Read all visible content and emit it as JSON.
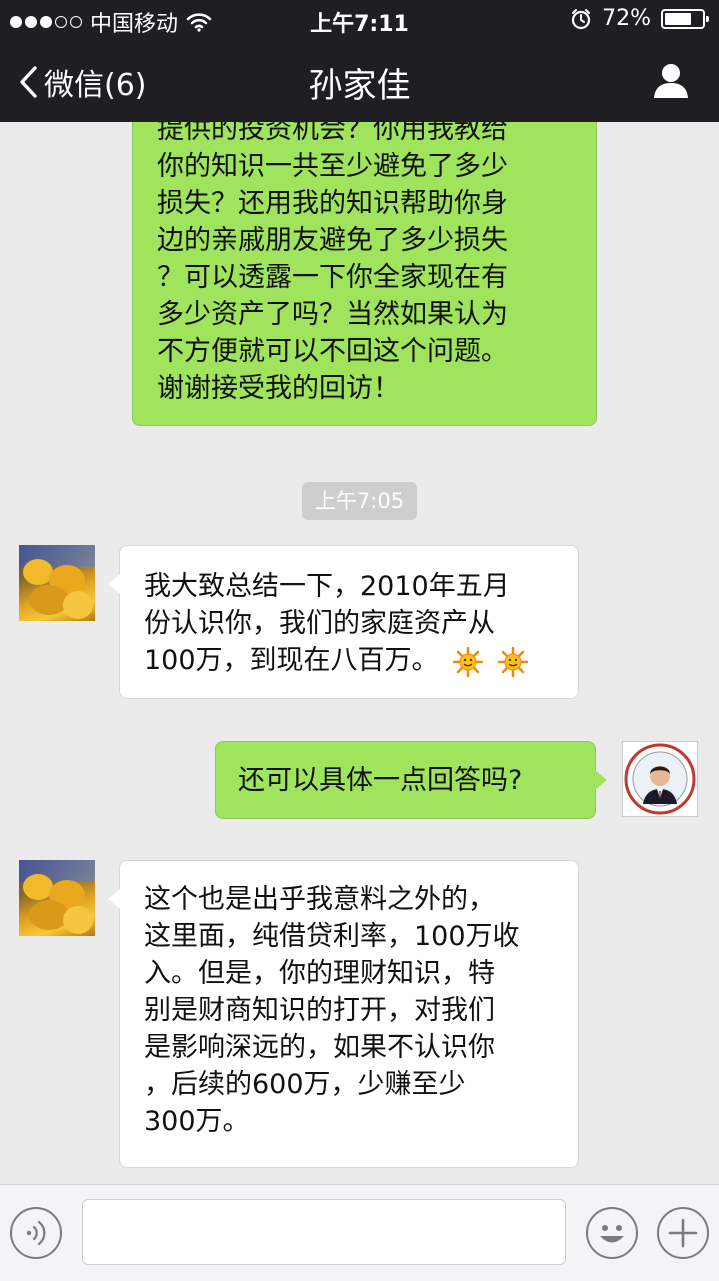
{
  "status_bar": {
    "carrier": "中国移动",
    "time": "上午7:11",
    "battery_percent": "72%",
    "battery_level": 0.72
  },
  "nav": {
    "back_label": "微信(6)",
    "title": "孙家佳"
  },
  "messages": [
    {
      "sender": "me",
      "lines": [
        "提供的投资机会？你用我教给",
        "你的知识一共至少避免了多少",
        "损失？还用我的知识帮助你身",
        "边的亲戚朋友避免了多少损失",
        "？可以透露一下你全家现在有",
        "多少资产了吗？当然如果认为",
        "不方便就可以不回这个问题。",
        "谢谢接受我的回访！"
      ]
    },
    {
      "type": "timestamp",
      "text": "上午7:05"
    },
    {
      "sender": "them",
      "lines": [
        "我大致总结一下，2010年五月",
        "份认识你，我们的家庭资产从",
        "100万，到现在八百万。"
      ],
      "emoji": [
        "sun-icon",
        "sun-icon"
      ]
    },
    {
      "sender": "me",
      "lines": [
        "还可以具体一点回答吗?"
      ]
    },
    {
      "sender": "them",
      "lines": [
        "这个也是出乎我意料之外的，",
        "这里面，纯借贷利率，100万收",
        "入。但是，你的理财知识，特",
        "别是财商知识的打开，对我们",
        "是影响深远的，如果不认识你",
        "，后续的600万，少赚至少",
        "300万。"
      ]
    }
  ],
  "colors": {
    "bar": "#1f1f23",
    "my_bubble": "#9fe45c",
    "their_bubble": "#ffffff",
    "background": "#ebebeb"
  }
}
